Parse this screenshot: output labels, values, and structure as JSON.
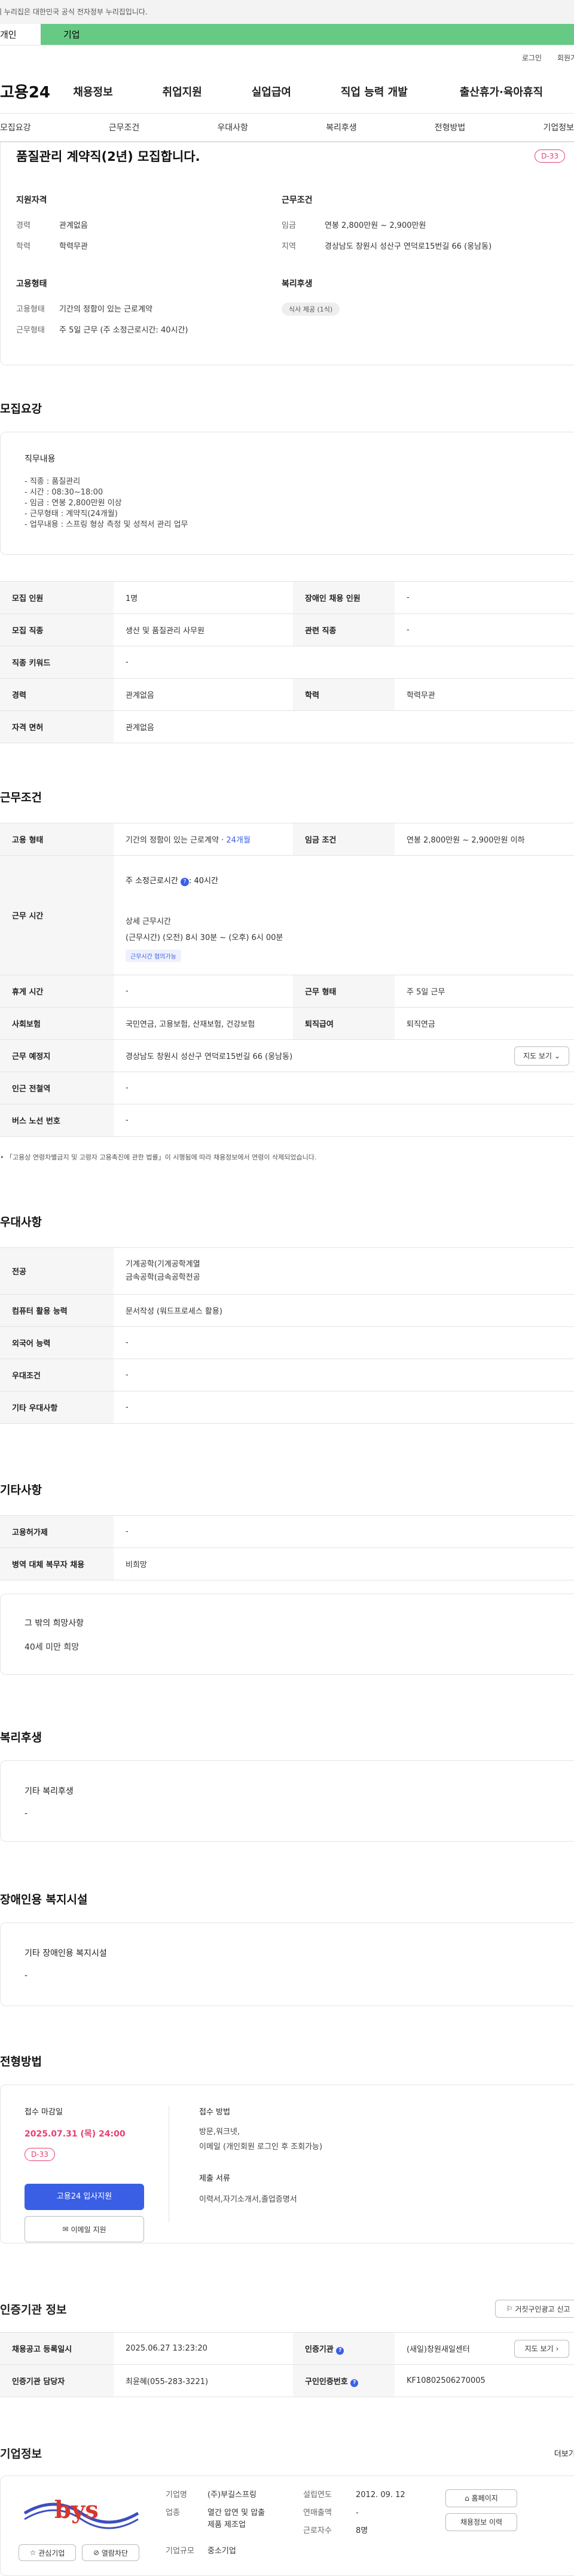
{
  "gov_banner": "이 누리집은 대한민국 공식 전자정부 누리집입니다.",
  "user_tabs": [
    "개인",
    "기업"
  ],
  "util": [
    "로그인",
    "회원가입"
  ],
  "brand": "고용24",
  "gnb": [
    "채용정보",
    "취업지원",
    "실업급여",
    "직업 능력 개발",
    "출산휴가·육아휴직"
  ],
  "subnav": [
    "모집요강",
    "근무조건",
    "우대사항",
    "복리후생",
    "전형방법",
    "기업정보"
  ],
  "summary": {
    "title": "품질관리 계약직(2년) 모집합니다.",
    "dday": "D-33",
    "qual_title": "지원자격",
    "career_lbl": "경력",
    "career": "관계없음",
    "edu_lbl": "학력",
    "edu": "학력무관",
    "cond_title": "근무조건",
    "wage_lbl": "임금",
    "wage": "연봉 2,800만원 ~ 2,900만원",
    "loc_lbl": "지역",
    "loc": "경상남도 창원시 성산구 연덕로15번길 66 (웅남동)",
    "emp_title": "고용형태",
    "type_lbl": "고용형태",
    "type": "기간의 정함이 있는 근로계약",
    "shape_lbl": "근무형태",
    "shape": "주 5일 근무 (주 소정근로시간: 40시간)",
    "welfare_title": "복리후생",
    "welfare_chip": "식사 제공 (1식)"
  },
  "recruit": {
    "title": "모집요강",
    "duty_title": "직무내용",
    "duties": [
      "- 직종 : 품질관리",
      "- 시간 : 08:30~18:00",
      "- 임금 : 연봉 2,800만원 이상",
      "- 근무형태 : 계약직(24개월)",
      "- 업무내용 : 스프링 형상 측정 및 성적서 관리 업무"
    ],
    "rows": [
      [
        "모집 인원",
        "1명",
        "장애인 채용 인원",
        "-"
      ],
      [
        "모집 직종",
        "생산 및 품질관리 사무원",
        "관련 직종",
        "-"
      ],
      [
        "직종 키워드",
        "-"
      ],
      [
        "경력",
        "관계없음",
        "학력",
        "학력무관"
      ],
      [
        "자격 면허",
        "관계없음"
      ]
    ]
  },
  "cond": {
    "title": "근무조건",
    "emp_h": "고용 형태",
    "emp": "기간의 정함이 있는 근로계약 · ",
    "emp_months": "24개월",
    "wage_h": "임금 조건",
    "wage": "연봉 2,800만원 ~ 2,900만원 이하",
    "time_h": "근무 시간",
    "weekly": "주 소정근로시간",
    "weekly_val": ": 40시간",
    "detail_t": "상세 근무시간",
    "detail": "(근무시간) (오전) 8시 30분 ~ (오후) 6시 00분",
    "consult": "근무시간 협의가능",
    "break_h": "휴게 시간",
    "break": "-",
    "form_h": "근무 형태",
    "form": "주 5일 근무",
    "ins_h": "사회보험",
    "ins": "국민연금, 고용보험, 산재보험, 건강보험",
    "ret_h": "퇴직급여",
    "ret": "퇴직연금",
    "place_h": "근무 예정지",
    "place": "경상남도 창원시 성산구 연덕로15번길 66 (웅남동)",
    "map_btn": "지도 보기",
    "metro_h": "인근 전철역",
    "metro": "-",
    "bus_h": "버스 노선 번호",
    "bus": "-",
    "note": "「고용상 연령차별금지 및 고령자 고용촉진에 관한 법률」이 시행됨에 따라 채용정보에서 연령이 삭제되었습니다."
  },
  "pref": {
    "title": "우대사항",
    "rows": [
      [
        "전공",
        "기계공학(기계공학계열\n금속공학(금속공학전공"
      ],
      [
        "컴퓨터 활용 능력",
        "문서작성 (워드프로세스 활용)"
      ],
      [
        "외국어 능력",
        "-"
      ],
      [
        "우대조건",
        "-"
      ],
      [
        "기타 우대사항",
        "-"
      ]
    ]
  },
  "etc": {
    "title": "기타사항",
    "rows": [
      [
        "고용허가제",
        "-"
      ],
      [
        "병역 대체 복무자 채용",
        "비희망"
      ]
    ],
    "hope_t": "그 밖의 희망사항",
    "hope": "40세 미만 희망"
  },
  "welfare": {
    "title": "복리후생",
    "box_t": "기타 복리후생",
    "box_v": "-"
  },
  "disabled": {
    "title": "장애인용 복지시설",
    "box_t": "기타 장애인용 복지시설",
    "box_v": "-"
  },
  "process": {
    "title": "전형방법",
    "deadline_t": "접수 마감일",
    "deadline": "2025.07.31 (목) 24:00",
    "dday": "D-33",
    "apply": "고용24 입사지원",
    "email": "이메일 지원",
    "method_t": "접수 방법",
    "method": [
      "방문,워크넷,",
      "이메일 (개인회원 로그인 후 조회가능)"
    ],
    "docs_t": "제출 서류",
    "docs": "이력서,자기소개서,졸업증명서"
  },
  "cert": {
    "title": "인증기관 정보",
    "report": "거짓구인광고 신고",
    "reg_h": "채용공고 등록일시",
    "reg": "2025.06.27 13:23:20",
    "org_h": "인증기관",
    "org": "(새일)창원새일센터",
    "map_btn": "지도 보기",
    "mgr_h": "인증기관 담당자",
    "mgr": "최윤혜(055-283-3221)",
    "no_h": "구인인증번호",
    "no": "KF10802506270005"
  },
  "company": {
    "title": "기업정보",
    "more": "더보기",
    "logo": "bys",
    "fav": "관심기업",
    "block": "열람차단",
    "name_l": "기업명",
    "name": "(주)부길스프링",
    "year_l": "설립연도",
    "year": "2012. 09. 12",
    "ind_l": "업종",
    "ind": [
      "열간 압연 및 압출",
      "제품 제조업"
    ],
    "sales_l": "연매출액",
    "sales": "-",
    "emp_l": "근로자수",
    "emp": "8명",
    "size_l": "기업규모",
    "size": "중소기업",
    "home": "홈페이지",
    "jobs": "채용정보 이력"
  },
  "colors": {
    "accent": "#3a5fe5",
    "dday": "#e64072",
    "green": "#66c984"
  }
}
